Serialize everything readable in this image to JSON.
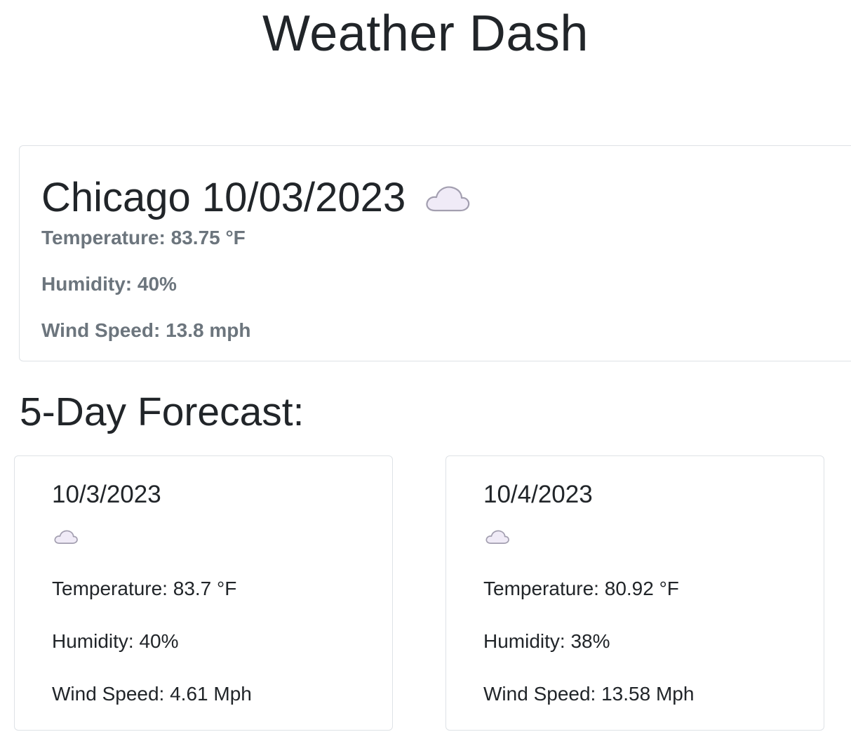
{
  "header": {
    "title": "Weather Dash"
  },
  "current": {
    "heading": "Chicago 10/03/2023",
    "icon": "cloud-icon",
    "temperature": "Temperature: 83.75 °F",
    "humidity": "Humidity: 40%",
    "wind": "Wind Speed: 13.8 mph"
  },
  "forecast": {
    "title": "5-Day Forecast:",
    "days": [
      {
        "date": "10/3/2023",
        "icon": "cloud-icon",
        "temperature": "Temperature: 83.7 °F",
        "humidity": "Humidity: 40%",
        "wind": "Wind Speed: 4.61 Mph"
      },
      {
        "date": "10/4/2023",
        "icon": "cloud-icon",
        "temperature": "Temperature: 80.92 °F",
        "humidity": "Humidity: 38%",
        "wind": "Wind Speed: 13.58 Mph"
      }
    ]
  },
  "colors": {
    "text": "#212529",
    "muted": "#6c757d",
    "border": "#dee2e6",
    "cloud_fill": "#f0ebf7",
    "cloud_stroke": "#a39fb0"
  }
}
